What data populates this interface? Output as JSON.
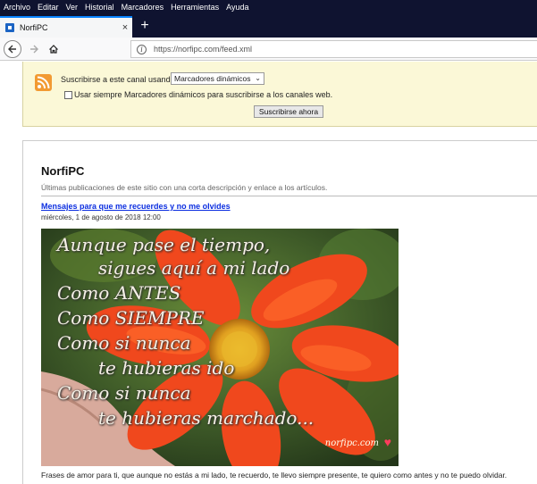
{
  "menu": [
    "Archivo",
    "Editar",
    "Ver",
    "Historial",
    "Marcadores",
    "Herramientas",
    "Ayuda"
  ],
  "tab": {
    "title": "NorfiPC",
    "close": "×"
  },
  "newtab": "+",
  "nav": {
    "url": "https://norfipc.com/feed.xml"
  },
  "subscribe": {
    "label": "Suscribirse a este canal usando",
    "select_value": "Marcadores dinámicos",
    "checkbox_label": "Usar siempre Marcadores dinámicos para suscribirse a los canales web.",
    "button": "Suscribirse ahora"
  },
  "feed": {
    "title": "NorfiPC",
    "description": "Últimas publicaciones de este sitio con una corta descripción y enlace a los artículos.",
    "post": {
      "title": "Mensajes para que me recuerdes y no me olvides",
      "date": "miércoles, 1 de agosto de 2018 12:00",
      "image_lines": [
        "Aunque pase el tiempo,",
        "sigues aquí a mi lado",
        "Como ANTES",
        "Como SIEMPRE",
        "Como si nunca",
        "te hubieras ido",
        "Como si nunca",
        "te hubieras marchado..."
      ],
      "watermark": "norfipc.com",
      "body": "Frases de amor para ti, que aunque no estás a mi lado, te recuerdo, te llevo siempre presente, te quiero como antes y no te puedo olvidar."
    }
  },
  "colors": {
    "menubar": "#0f1330",
    "accent": "#0a84ff",
    "panel": "#fbf8d7",
    "link": "#0b2ee0",
    "rss": "#f29a33"
  }
}
